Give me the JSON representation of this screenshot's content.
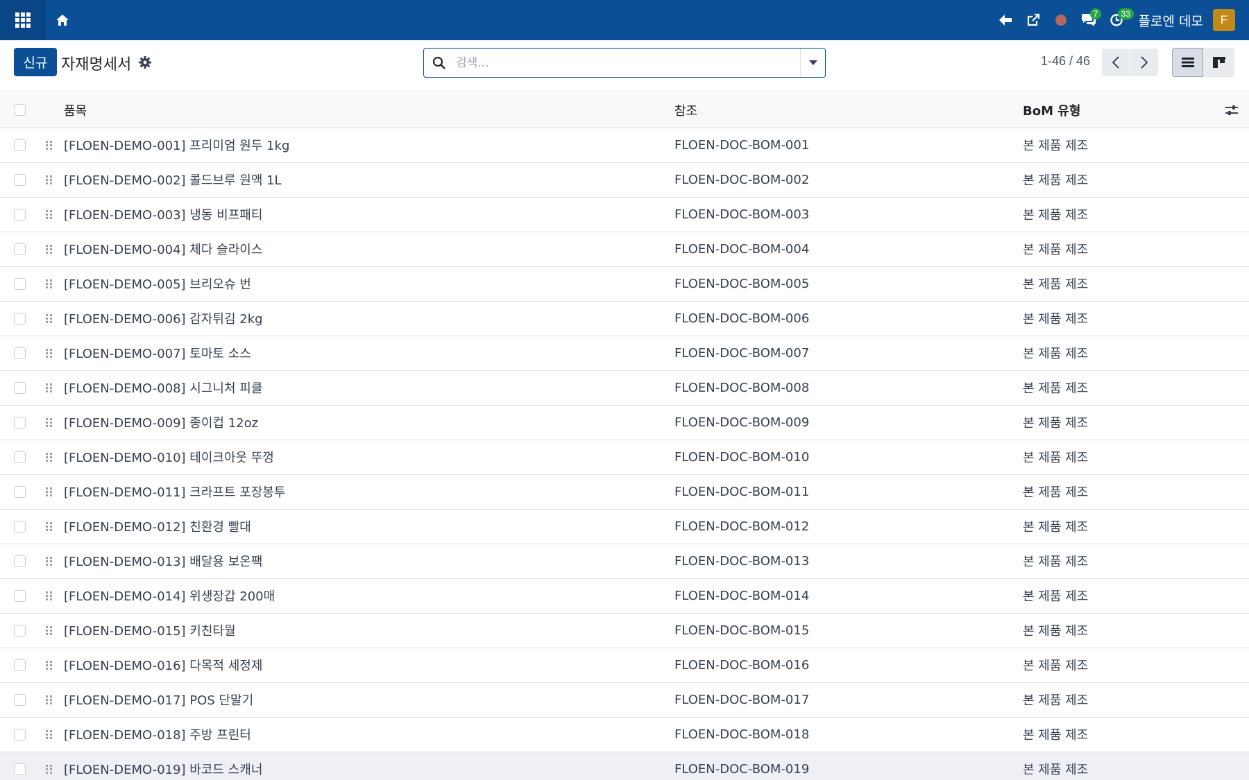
{
  "nav": {
    "chat_badge": "7",
    "activity_badge": "33",
    "user_name": "플로엔 데모",
    "user_initial": "F",
    "status_color": "#b5695c",
    "accent_color": "#0b4f96"
  },
  "control": {
    "new_button": "신규",
    "title": "자재명세서",
    "search_placeholder": "검색...",
    "pager": "1-46 / 46"
  },
  "table": {
    "columns": [
      "품목",
      "참조",
      "BoM 유형"
    ],
    "rows": [
      {
        "product": "[FLOEN-DEMO-001] 프리미엄 원두 1kg",
        "reference": "FLOEN-DOC-BOM-001",
        "bom_type": "본 제품 제조"
      },
      {
        "product": "[FLOEN-DEMO-002] 콜드브루 원액 1L",
        "reference": "FLOEN-DOC-BOM-002",
        "bom_type": "본 제품 제조"
      },
      {
        "product": "[FLOEN-DEMO-003] 냉동 비프패티",
        "reference": "FLOEN-DOC-BOM-003",
        "bom_type": "본 제품 제조"
      },
      {
        "product": "[FLOEN-DEMO-004] 체다 슬라이스",
        "reference": "FLOEN-DOC-BOM-004",
        "bom_type": "본 제품 제조"
      },
      {
        "product": "[FLOEN-DEMO-005] 브리오슈 번",
        "reference": "FLOEN-DOC-BOM-005",
        "bom_type": "본 제품 제조"
      },
      {
        "product": "[FLOEN-DEMO-006] 감자튀김 2kg",
        "reference": "FLOEN-DOC-BOM-006",
        "bom_type": "본 제품 제조"
      },
      {
        "product": "[FLOEN-DEMO-007] 토마토 소스",
        "reference": "FLOEN-DOC-BOM-007",
        "bom_type": "본 제품 제조"
      },
      {
        "product": "[FLOEN-DEMO-008] 시그니처 피클",
        "reference": "FLOEN-DOC-BOM-008",
        "bom_type": "본 제품 제조"
      },
      {
        "product": "[FLOEN-DEMO-009] 종이컵 12oz",
        "reference": "FLOEN-DOC-BOM-009",
        "bom_type": "본 제품 제조"
      },
      {
        "product": "[FLOEN-DEMO-010] 테이크아웃 뚜껑",
        "reference": "FLOEN-DOC-BOM-010",
        "bom_type": "본 제품 제조"
      },
      {
        "product": "[FLOEN-DEMO-011] 크라프트 포장봉투",
        "reference": "FLOEN-DOC-BOM-011",
        "bom_type": "본 제품 제조"
      },
      {
        "product": "[FLOEN-DEMO-012] 친환경 빨대",
        "reference": "FLOEN-DOC-BOM-012",
        "bom_type": "본 제품 제조"
      },
      {
        "product": "[FLOEN-DEMO-013] 배달용 보온팩",
        "reference": "FLOEN-DOC-BOM-013",
        "bom_type": "본 제품 제조"
      },
      {
        "product": "[FLOEN-DEMO-014] 위생장갑 200매",
        "reference": "FLOEN-DOC-BOM-014",
        "bom_type": "본 제품 제조"
      },
      {
        "product": "[FLOEN-DEMO-015] 키친타월",
        "reference": "FLOEN-DOC-BOM-015",
        "bom_type": "본 제품 제조"
      },
      {
        "product": "[FLOEN-DEMO-016] 다목적 세정제",
        "reference": "FLOEN-DOC-BOM-016",
        "bom_type": "본 제품 제조"
      },
      {
        "product": "[FLOEN-DEMO-017] POS 단말기",
        "reference": "FLOEN-DOC-BOM-017",
        "bom_type": "본 제품 제조"
      },
      {
        "product": "[FLOEN-DEMO-018] 주방 프린터",
        "reference": "FLOEN-DOC-BOM-018",
        "bom_type": "본 제품 제조"
      },
      {
        "product": "[FLOEN-DEMO-019] 바코드 스캐너",
        "reference": "FLOEN-DOC-BOM-019",
        "bom_type": "본 제품 제조"
      }
    ]
  }
}
